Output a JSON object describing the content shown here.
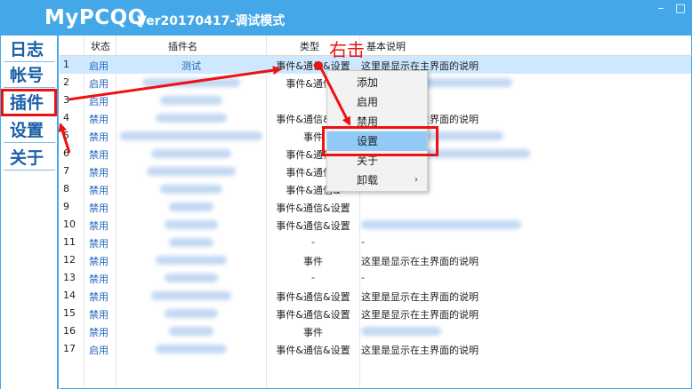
{
  "window": {
    "title": "MyPCQQ",
    "subtitle": "Ver20170417-调试模式",
    "minimize_glyph": "–",
    "close_glyph": "□"
  },
  "sidebar": {
    "items": [
      {
        "label": "日志"
      },
      {
        "label": "帐号"
      },
      {
        "label": "插件",
        "active": true
      },
      {
        "label": "设置"
      },
      {
        "label": "关于"
      }
    ]
  },
  "table": {
    "columns": [
      "",
      "状态",
      "插件名",
      "类型",
      "基本说明"
    ],
    "rows": [
      {
        "index": "1",
        "status": "启用",
        "name": "测试",
        "type": "事件&通信&设置",
        "desc": "这里是显示在主界面的说明",
        "selected": true
      },
      {
        "index": "2",
        "status": "启用",
        "name": "",
        "type": "事件&通信&",
        "desc": ""
      },
      {
        "index": "3",
        "status": "启用",
        "name": "",
        "type": "",
        "desc": ""
      },
      {
        "index": "4",
        "status": "禁用",
        "name": "",
        "type": "事件&通信&设置",
        "desc": "这里是显示在主界面的说明"
      },
      {
        "index": "5",
        "status": "禁用",
        "name": "",
        "type": "事件",
        "desc": ""
      },
      {
        "index": "6",
        "status": "禁用",
        "name": "",
        "type": "事件&通信&",
        "desc": ""
      },
      {
        "index": "7",
        "status": "禁用",
        "name": "",
        "type": "事件&通信&",
        "desc": ""
      },
      {
        "index": "8",
        "status": "禁用",
        "name": "",
        "type": "事件&通信&",
        "desc": ""
      },
      {
        "index": "9",
        "status": "禁用",
        "name": "",
        "type": "事件&通信&设置",
        "desc": ""
      },
      {
        "index": "10",
        "status": "禁用",
        "name": "",
        "type": "事件&通信&设置",
        "desc": ""
      },
      {
        "index": "11",
        "status": "禁用",
        "name": "",
        "type": "-",
        "desc": "-"
      },
      {
        "index": "12",
        "status": "禁用",
        "name": "",
        "type": "事件",
        "desc": "这里是显示在主界面的说明"
      },
      {
        "index": "13",
        "status": "禁用",
        "name": "",
        "type": "-",
        "desc": "-"
      },
      {
        "index": "14",
        "status": "禁用",
        "name": "",
        "type": "事件&通信&设置",
        "desc": "这里是显示在主界面的说明"
      },
      {
        "index": "15",
        "status": "禁用",
        "name": "",
        "type": "事件&通信&设置",
        "desc": "这里是显示在主界面的说明"
      },
      {
        "index": "16",
        "status": "禁用",
        "name": "",
        "type": "事件",
        "desc": ""
      },
      {
        "index": "17",
        "status": "启用",
        "name": "",
        "type": "事件&通信&设置",
        "desc": "这里是显示在主界面的说明"
      }
    ]
  },
  "context_menu": {
    "items": [
      {
        "label": "添加"
      },
      {
        "label": "启用"
      },
      {
        "label": "禁用"
      },
      {
        "label": "设置",
        "hover": true
      },
      {
        "label": "关于"
      },
      {
        "label": "卸载",
        "submenu": true
      }
    ],
    "submenu_glyph": "›"
  },
  "annotation": {
    "text": "右击",
    "color": "#ee1111"
  },
  "colors": {
    "accent": "#44a8e8",
    "selected_row": "#cde8ff",
    "menu_hover": "#91c9f7",
    "annotation_red": "#ee1111"
  }
}
